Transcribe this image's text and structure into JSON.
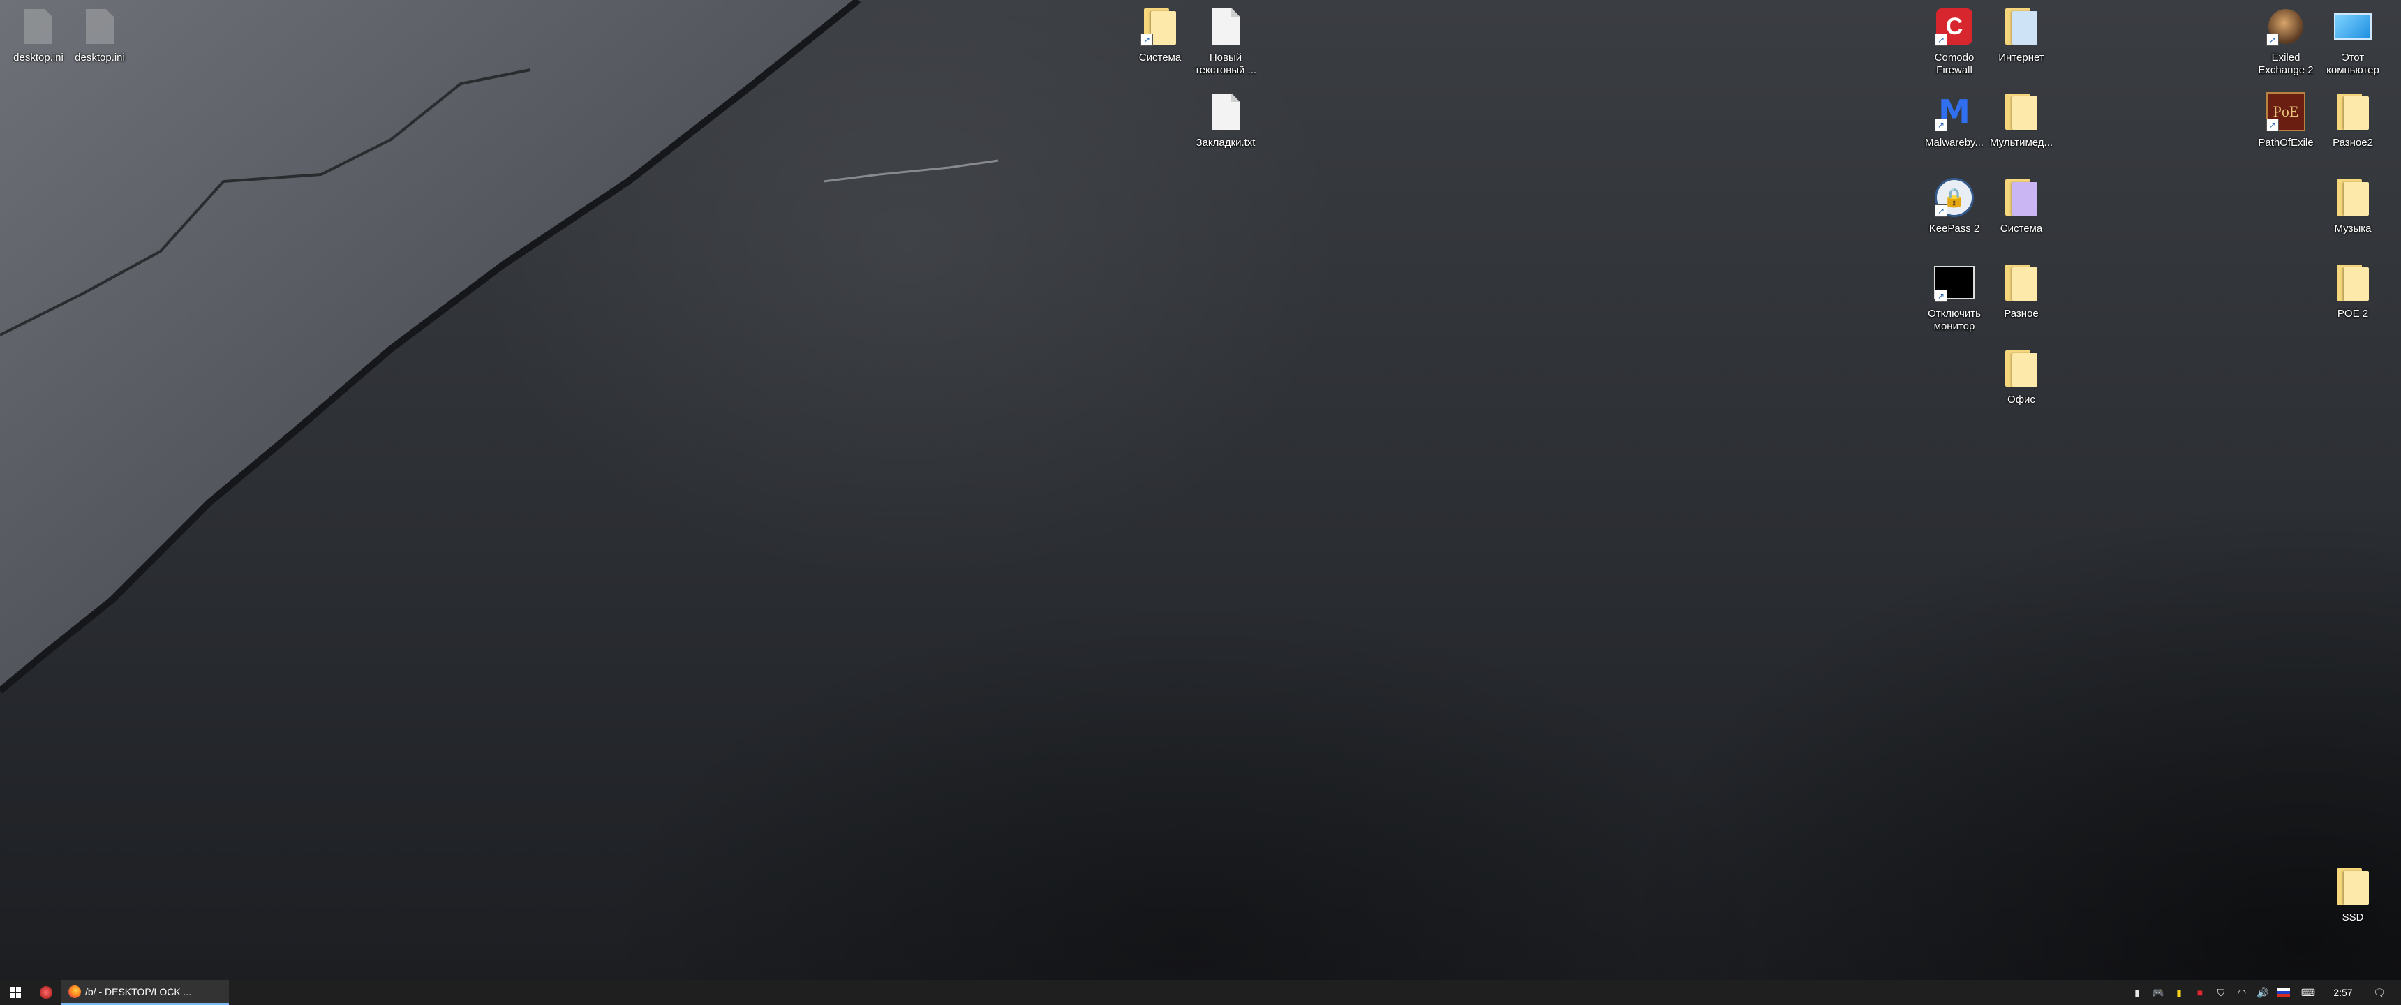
{
  "desktop": {
    "icons": {
      "ghost1": {
        "label": "desktop.ini"
      },
      "ghost2": {
        "label": "desktop.ini"
      },
      "sistema_top": {
        "label": "Система"
      },
      "new_text": {
        "label": "Новый текстовый ..."
      },
      "bookmarks": {
        "label": "Закладки.txt"
      },
      "comodo": {
        "label": "Comodo Firewall"
      },
      "internet": {
        "label": "Интернет"
      },
      "malwarebytes": {
        "label": "Malwareby..."
      },
      "multimedia": {
        "label": "Мультимед..."
      },
      "keepass": {
        "label": "KeePass 2"
      },
      "sistema_right": {
        "label": "Система"
      },
      "monitor_off": {
        "label": "Отключить монитор"
      },
      "raznoe": {
        "label": "Разное"
      },
      "ofis": {
        "label": "Офис"
      },
      "exiled": {
        "label": "Exiled Exchange 2"
      },
      "this_pc": {
        "label": "Этот компьютер"
      },
      "poe": {
        "label": "PathOfExile"
      },
      "raznoe2": {
        "label": "Разное2"
      },
      "muzyka": {
        "label": "Музыка"
      },
      "poe2": {
        "label": "POE 2"
      },
      "ssd": {
        "label": "SSD"
      }
    }
  },
  "taskbar": {
    "task_title": "/b/ - DESKTOP/LOCK ...",
    "clock": "2:57",
    "icons": [
      "windows-start-icon",
      "app-pin-icon",
      "firefox-icon",
      "tray-icons",
      "notification-icon"
    ]
  },
  "colors": {
    "taskbar_bg": "#1f1f1f",
    "active_task_underline": "#7bb8f3",
    "folder": "#f6d77c"
  }
}
